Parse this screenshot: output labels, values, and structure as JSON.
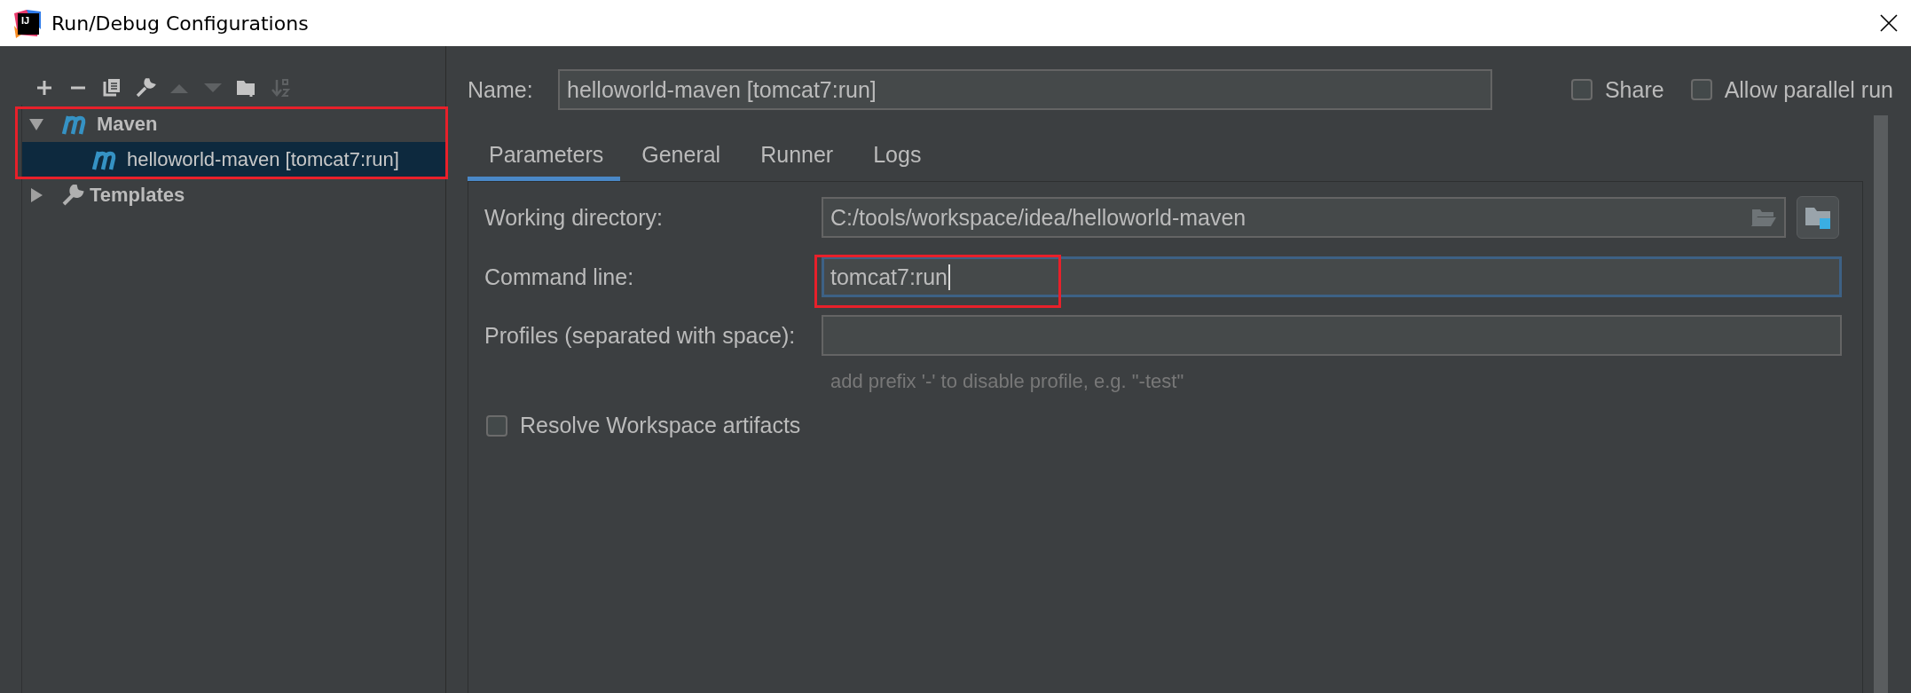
{
  "window": {
    "title": "Run/Debug Configurations",
    "logo_text": "IJ"
  },
  "toolbar": [
    {
      "kind": "add",
      "disabled": false
    },
    {
      "kind": "remove",
      "disabled": false
    },
    {
      "kind": "copy",
      "disabled": false
    },
    {
      "kind": "wrench",
      "disabled": false
    },
    {
      "kind": "up",
      "disabled": true
    },
    {
      "kind": "down",
      "disabled": true
    },
    {
      "kind": "folder",
      "disabled": false
    },
    {
      "kind": "sort",
      "disabled": true
    }
  ],
  "tree": [
    {
      "label": "Maven",
      "kind": "maven",
      "expanded": true,
      "selected": false,
      "highlighted": true,
      "children": [
        {
          "label": "helloworld-maven [tomcat7:run]",
          "kind": "maven",
          "selected": true
        }
      ]
    },
    {
      "label": "Templates",
      "kind": "wrench",
      "expanded": false,
      "selected": false,
      "highlighted": false
    }
  ],
  "name": {
    "label": "Name:",
    "value": "helloworld-maven [tomcat7:run]"
  },
  "top_options": [
    {
      "label": "Share",
      "checked": false
    },
    {
      "label": "Allow parallel run",
      "checked": false
    }
  ],
  "tabs": [
    {
      "label": "Parameters",
      "selected": true
    },
    {
      "label": "General",
      "selected": false
    },
    {
      "label": "Runner",
      "selected": false
    },
    {
      "label": "Logs",
      "selected": false
    }
  ],
  "fields": [
    {
      "kind": "path",
      "label": "Working directory:",
      "value": "C:/tools/workspace/idea/helloworld-maven",
      "focused": false,
      "highlighted": false
    },
    {
      "kind": "text",
      "label": "Command line:",
      "value": "tomcat7:run",
      "focused": true,
      "highlighted": true
    },
    {
      "kind": "text",
      "label": "Profiles (separated with space):",
      "hint": "add prefix '-' to disable profile, e.g. \"-test\"",
      "focused": false,
      "highlighted": false
    }
  ],
  "options": [
    {
      "label": "Resolve Workspace artifacts",
      "checked": false
    }
  ]
}
